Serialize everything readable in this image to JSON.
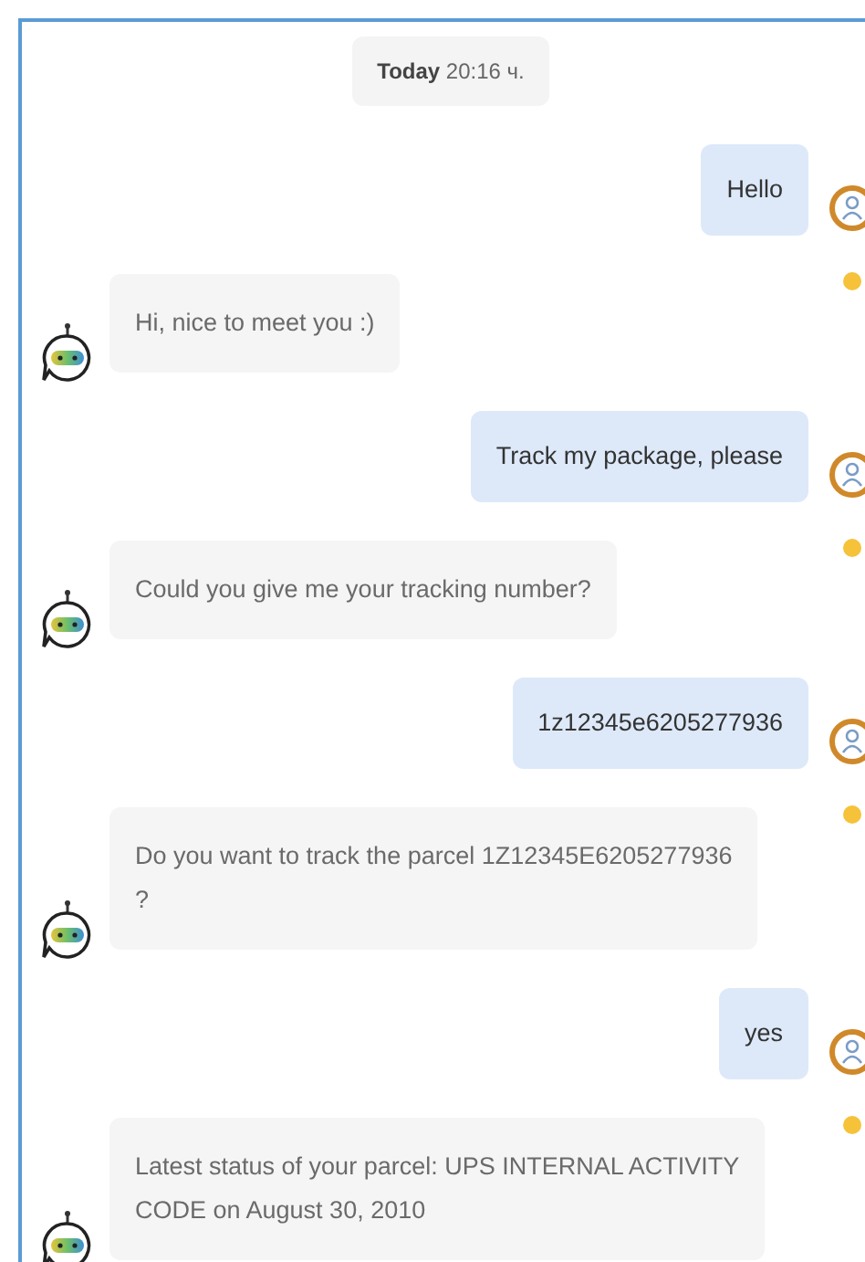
{
  "date_label": "**Today** 20:16 ч.",
  "messages": [
    {
      "kind": "user",
      "text": "Hello"
    },
    {
      "kind": "bot",
      "text": "Hi, nice to meet you :)"
    },
    {
      "kind": "user",
      "text": "Track my package, please"
    },
    {
      "kind": "bot",
      "text": "Could you give me your tracking number?"
    },
    {
      "kind": "user",
      "text": "1z12345e6205277936"
    },
    {
      "kind": "bot",
      "text": "Do you want to track the parcel 1Z12345E6205277936\n?"
    },
    {
      "kind": "user",
      "text": "yes"
    },
    {
      "kind": "bot",
      "text": "Latest status of your parcel: UPS INTERNAL ACTIVITY\nCODE on August 30, 2010"
    }
  ]
}
